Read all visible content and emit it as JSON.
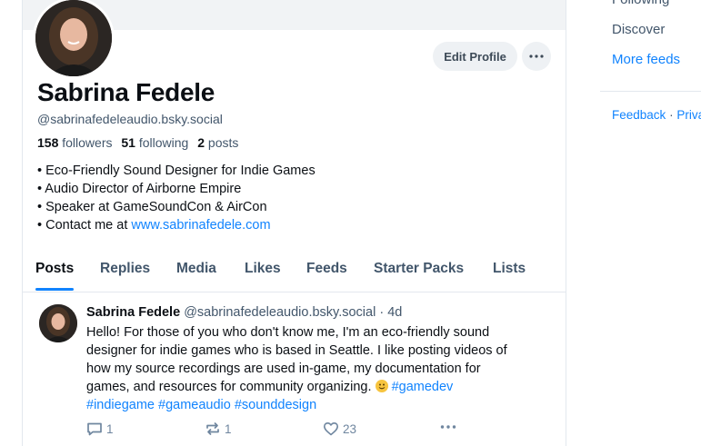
{
  "profile": {
    "display_name": "Sabrina Fedele",
    "handle": "@sabrinafedeleaudio.bsky.social",
    "edit_profile_label": "Edit Profile",
    "followers_count": "158",
    "followers_label": "followers",
    "following_count": "51",
    "following_label": "following",
    "posts_count": "2",
    "posts_label": "posts",
    "bio": [
      "• Eco-Friendly Sound Designer for Indie Games",
      "• Audio Director of Airborne Empire",
      "• Speaker at GameSoundCon & AirCon"
    ],
    "bio_contact_prefix": "• Contact me at ",
    "bio_contact_link": "www.sabrinafedele.com"
  },
  "tabs": [
    "Posts",
    "Replies",
    "Media",
    "Likes",
    "Feeds",
    "Starter Packs",
    "Lists"
  ],
  "post": {
    "author": "Sabrina Fedele",
    "handle": "@sabrinafedeleaudio.bsky.social",
    "age": "· 4d",
    "text_line1": "Hello! For those of you who don't know me, I'm an eco-friendly sound",
    "text_line2": "designer for indie games who is based in Seattle. I like posting videos of",
    "text_line3": "how my source recordings are used in-game, my documentation for",
    "text_line4_start": "games, and resources for community organizing.",
    "hashtags_line4": "#gamedev",
    "hashtags_line5": "#indiegame #gameaudio #sounddesign",
    "reply_count": "1",
    "repost_count": "1",
    "like_count": "23"
  },
  "right_nav": {
    "following": "Following",
    "discover": "Discover",
    "more_feeds": "More feeds",
    "footer_feedback": "Feedback",
    "footer_sep": "·",
    "footer_privacy": "Privacy"
  },
  "colors": {
    "accent": "#1083fe",
    "muted_text": "#42566b",
    "border": "#e3e8ee"
  },
  "icons": [
    "more-horizontal-icon",
    "reply-icon",
    "repost-icon",
    "like-icon",
    "post-more-icon",
    "smile-emoji-icon"
  ]
}
